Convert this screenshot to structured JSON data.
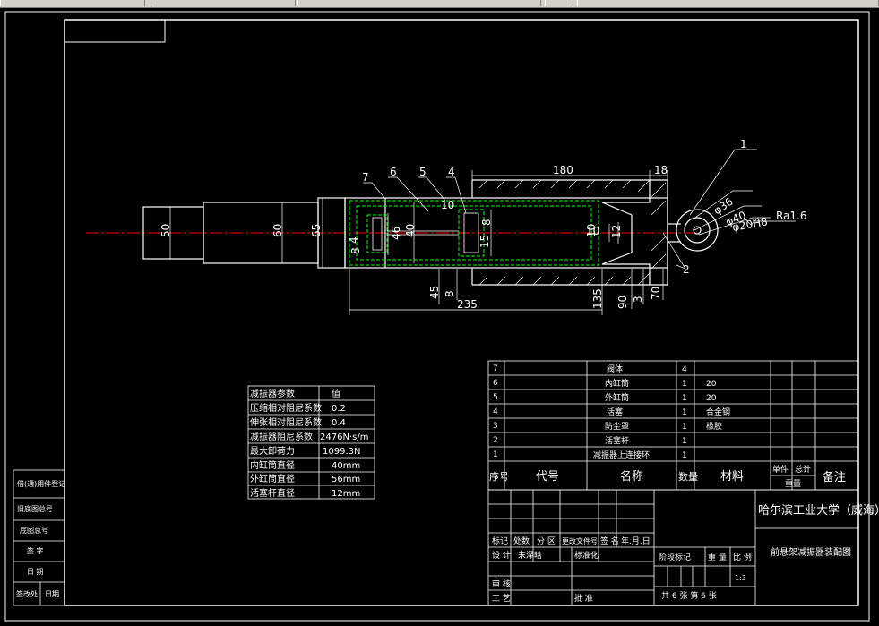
{
  "colors": {
    "bg": "#000000",
    "frame": "#ffffff",
    "dim": "#ffffff",
    "part": "#ffffff",
    "hidden": "#00ff00",
    "dash": "#ff0000",
    "table_text": "#ffffff"
  },
  "drawing": {
    "labels": {
      "d50": "50",
      "d60": "60",
      "d65": "65",
      "d46": "46",
      "d40": "40",
      "l180": "180",
      "l18": "18",
      "l10a": "10",
      "l10b": "10",
      "l8a": "8",
      "l8b": "8",
      "l15": "15",
      "l12": "12",
      "l4": "4",
      "l10c": "10",
      "l45": "45",
      "l8c": "8",
      "l135": "135",
      "l90": "90",
      "l3": "3",
      "l70": "70",
      "l235": "235",
      "phi36": "φ36",
      "phi40": "φ40",
      "phi20": "φ20H8",
      "ra": "Ra1.6",
      "n1": "1",
      "n2": "2",
      "n4": "4",
      "n5": "5",
      "n6": "6",
      "n7": "7"
    }
  },
  "params": {
    "header": [
      "减振器参数",
      "值"
    ],
    "rows": [
      [
        "压缩相对阻尼系数",
        "0.2"
      ],
      [
        "伸张相对阻尼系数",
        "0.4"
      ],
      [
        "减振器阻尼系数",
        "2476N·s/m"
      ],
      [
        "最大卸荷力",
        "1099.3N"
      ],
      [
        "内缸筒直径",
        "40mm"
      ],
      [
        "外缸筒直径",
        "56mm"
      ],
      [
        "活塞杆直径",
        "12mm"
      ]
    ]
  },
  "bom": {
    "rows": [
      {
        "no": "7",
        "code": "",
        "name": "阀体",
        "qty": "4",
        "mat": "",
        "wt1": "",
        "wt2": "",
        "note": ""
      },
      {
        "no": "6",
        "code": "",
        "name": "内缸筒",
        "qty": "1",
        "mat": "20",
        "wt1": "",
        "wt2": "",
        "note": ""
      },
      {
        "no": "5",
        "code": "",
        "name": "外缸筒",
        "qty": "1",
        "mat": "20",
        "wt1": "",
        "wt2": "",
        "note": ""
      },
      {
        "no": "4",
        "code": "",
        "name": "活塞",
        "qty": "1",
        "mat": "合金钢",
        "wt1": "",
        "wt2": "",
        "note": ""
      },
      {
        "no": "3",
        "code": "",
        "name": "防尘罩",
        "qty": "1",
        "mat": "橡胶",
        "wt1": "",
        "wt2": "",
        "note": ""
      },
      {
        "no": "2",
        "code": "",
        "name": "活塞杆",
        "qty": "1",
        "mat": "",
        "wt1": "",
        "wt2": "",
        "note": ""
      },
      {
        "no": "1",
        "code": "",
        "name": "减振器上连接环",
        "qty": "1",
        "mat": "",
        "wt1": "",
        "wt2": "",
        "note": ""
      }
    ],
    "header": {
      "no": "序号",
      "code": "代号",
      "name": "名称",
      "qty": "数量",
      "mat": "材料",
      "wt_single": "单件",
      "wt_total": "总计",
      "wt": "重量",
      "note": "备注"
    }
  },
  "title_block": {
    "school": "哈尔滨工业大学（威海）",
    "drawing_name": "前悬架减振器装配图",
    "rev_headers": [
      "标记",
      "处数",
      "分 区",
      "更改文件号",
      "签 名",
      "年.月.日"
    ],
    "design_label": "设 计",
    "designer": "宋泽晗",
    "standardize": "标准化",
    "stage_label": "阶段标记",
    "weight_label": "重 量",
    "scale_label": "比 例",
    "scale_value": "1:3",
    "review_label": "审 核",
    "process_label": "工 艺",
    "approve_label": "批 准",
    "sheets": "共 6 张  第 6 张"
  },
  "side_block": {
    "rows": [
      "借(通)用件登记",
      "旧底图总号",
      "底图总号",
      "签 字",
      "日 期"
    ],
    "bottom": [
      "签改处",
      "日期"
    ]
  }
}
